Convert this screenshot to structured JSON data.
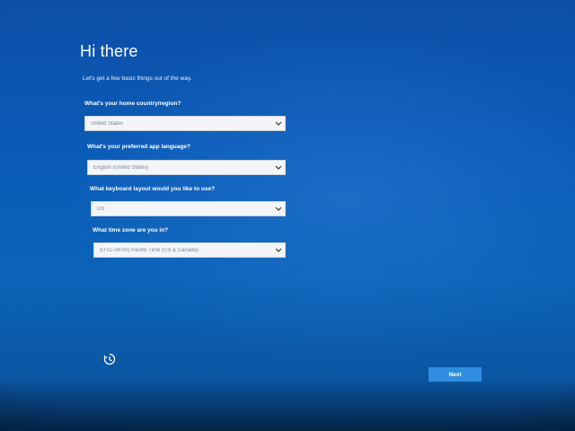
{
  "page": {
    "title": "Hi there",
    "subtitle": "Let's get a few basic things out of the way."
  },
  "fields": [
    {
      "label": "What's your home country/region?",
      "value": "United States"
    },
    {
      "label": "What's your preferred app language?",
      "value": "English (United States)"
    },
    {
      "label": "What keyboard layout would you like to use?",
      "value": "US"
    },
    {
      "label": "What time zone are you in?",
      "value": "(UTC-08:00) Pacific Time (US & Canada)"
    }
  ],
  "footer": {
    "ease_of_access_icon": "ease-of-access-icon",
    "next_label": "Next"
  },
  "colors": {
    "background": "#0a5bb6",
    "button": "#2f8ee0",
    "dropdown": "#f3f5f8"
  }
}
